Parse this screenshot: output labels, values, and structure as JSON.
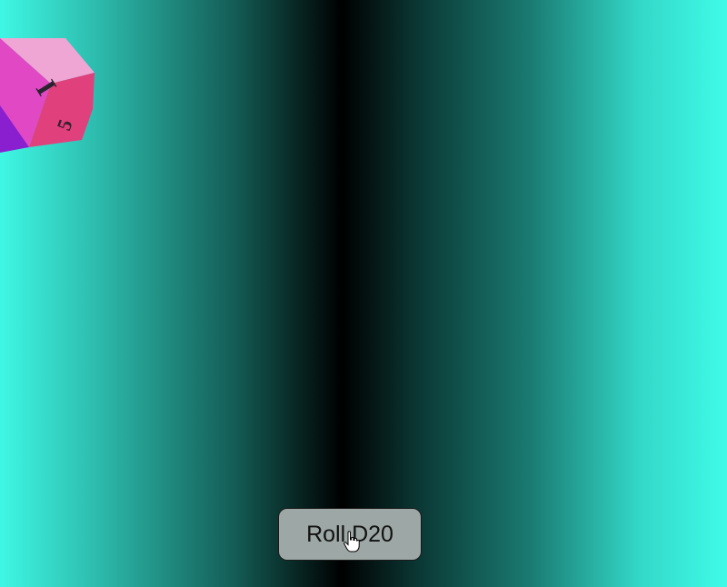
{
  "page": {
    "background_colors": [
      "#3ff7e4",
      "#000000",
      "#40fbe8"
    ]
  },
  "die": {
    "icon": "d20-die-icon",
    "face_numbers": [
      "I",
      "5"
    ],
    "colors": {
      "main_face": "#e048c4",
      "top_face": "#f0a6d4",
      "side_face": "#e0407c",
      "left_face": "#8a1fd0"
    }
  },
  "controls": {
    "roll_button_label": "Roll D20",
    "roll_button_color": "#9da7a5"
  },
  "cursor": {
    "icon": "hand-pointer-icon"
  }
}
